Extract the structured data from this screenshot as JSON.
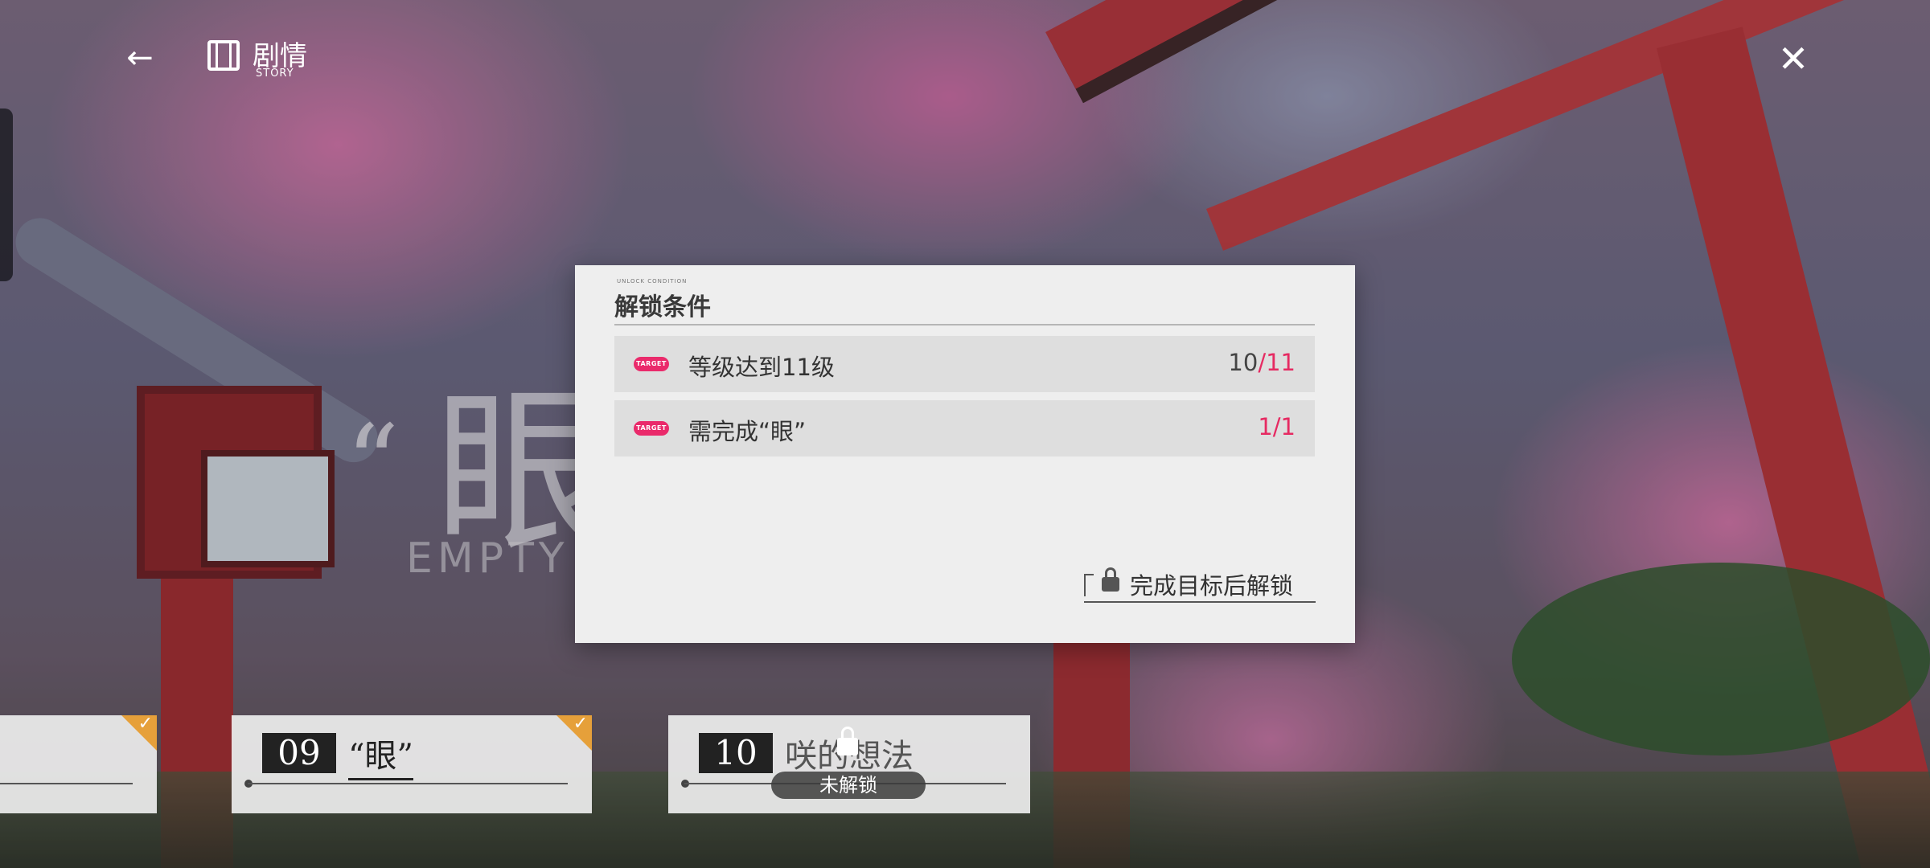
{
  "header": {
    "back_icon": "back-arrow-icon",
    "section_icon": "film-strip-icon",
    "title": "剧情",
    "subtitle": "STORY",
    "close_icon": "close-icon"
  },
  "background": {
    "big_char": "眼",
    "quote": "“",
    "subtitle": "EMPTY EY"
  },
  "chapters": [
    {
      "number": "",
      "title": "",
      "completed": true
    },
    {
      "number": "09",
      "title": "“眼”",
      "completed": true
    },
    {
      "number": "10",
      "title": "咲的想法",
      "completed": false,
      "locked_label": "未解锁"
    }
  ],
  "modal": {
    "tiny_caption": "UNLOCK CONDITION",
    "title": "解锁条件",
    "conditions": [
      {
        "badge": "TARGET",
        "label": "等级达到11级",
        "current": "10",
        "sep": "/",
        "total": "11",
        "done": false
      },
      {
        "badge": "TARGET",
        "label": "需完成“眼”",
        "current": "1",
        "sep": "/",
        "total": "1",
        "done": true
      }
    ],
    "unlock_icon": "lock-icon",
    "unlock_button": "完成目标后解锁"
  },
  "colors": {
    "accent": "#e62a62",
    "completed_corner": "#e6a03a",
    "modal_bg": "#eeeeee"
  }
}
